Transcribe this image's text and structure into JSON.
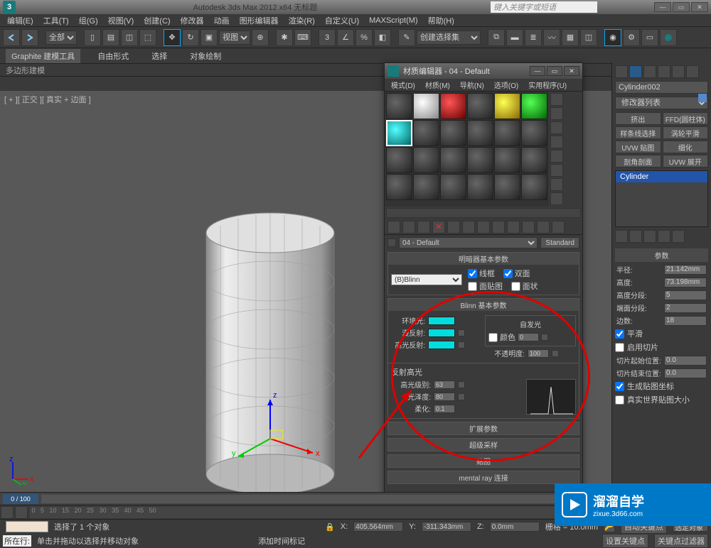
{
  "titlebar": {
    "app_title": "Autodesk 3ds Max 2012 x64   无标题",
    "search_placeholder": "键入关键字或短语"
  },
  "menubar": [
    "编辑(E)",
    "工具(T)",
    "组(G)",
    "视图(V)",
    "创建(C)",
    "修改器",
    "动画",
    "图形编辑器",
    "渲染(R)",
    "自定义(U)",
    "MAXScript(M)",
    "帮助(H)"
  ],
  "toolbar": {
    "layer_selector": "全部",
    "viewport_btn": "视图",
    "selection_set": "创建选择集"
  },
  "ribbon": {
    "tabs": [
      "Graphite 建模工具",
      "自由形式",
      "选择",
      "对象绘制"
    ],
    "sub": "多边形建模"
  },
  "viewport": {
    "label": "[ + ][ 正交 ][ 真实 + 边面 ]"
  },
  "rightpanel": {
    "object_name": "Cylinder002",
    "modifier_list": "修改器列表",
    "buttons": [
      [
        "挤出",
        "FFD(圆柱体)"
      ],
      [
        "样条线选择",
        "涡轮平滑"
      ],
      [
        "UVW 贴图",
        "细化"
      ],
      [
        "剖角剖面",
        "UVW 展开"
      ]
    ],
    "stack_item": "Cylinder",
    "rollup_title": "参数",
    "params": {
      "radius": {
        "label": "半径:",
        "value": "21.142mm"
      },
      "height": {
        "label": "高度:",
        "value": "73.198mm"
      },
      "height_segs": {
        "label": "高度分段:",
        "value": "5"
      },
      "cap_segs": {
        "label": "端面分段:",
        "value": "2"
      },
      "sides": {
        "label": "边数:",
        "value": "18"
      },
      "smooth": {
        "label": "平滑",
        "checked": true
      },
      "slice": {
        "label": "启用切片",
        "checked": false
      },
      "slice_from": {
        "label": "切片起始位置:",
        "value": "0.0"
      },
      "slice_to": {
        "label": "切片结束位置:",
        "value": "0.0"
      },
      "gen_uv": {
        "label": "生成贴图坐标",
        "checked": true
      },
      "real_world": {
        "label": "真实世界贴图大小",
        "checked": false
      }
    }
  },
  "material_editor": {
    "window_title": "材质编辑器 - 04 - Default",
    "menu": [
      "模式(D)",
      "材质(M)",
      "导航(N)",
      "选项(O)",
      "实用程序(U)"
    ],
    "material_name": "04 - Default",
    "type_button": "Standard",
    "rollup_shader": {
      "title": "明暗器基本参数",
      "shader": "(B)Blinn",
      "wire": "线框",
      "two_sided": "双面",
      "face_map": "面贴图",
      "faceted": "面状"
    },
    "rollup_blinn": {
      "title": "Blinn 基本参数",
      "ambient": "环境光:",
      "diffuse": "漫反射:",
      "specular": "高光反射:",
      "self_illum_title": "自发光",
      "self_illum_color": "颜色",
      "self_illum_value": "0",
      "opacity_label": "不透明度:",
      "opacity_value": "100",
      "spec_title": "反射高光",
      "spec_level": {
        "label": "高光级别:",
        "value": "63"
      },
      "glossiness": {
        "label": "光泽度:",
        "value": "80"
      },
      "soften": {
        "label": "柔化:",
        "value": "0.1"
      }
    },
    "extra_rollups": [
      "扩展参数",
      "超级采样",
      "贴图",
      "mental ray 连接"
    ]
  },
  "statusbar": {
    "timeframe": "0 / 100",
    "sel_count": "选择了 1 个对象",
    "hint": "单击并拖动以选择并移动对象",
    "timetag": "添加时间标记",
    "x": "X:",
    "x_val": "405.564mm",
    "y": "Y:",
    "y_val": "-311.343mm",
    "z": "Z:",
    "z_val": "0.0mm",
    "grid": "栅格 = 10.0mm",
    "autokey": "自动关键点",
    "selected": "选定对象",
    "setkey": "设置关键点",
    "keyfilter": "关键点过滤器",
    "now": "所在行:"
  },
  "watermark": {
    "big": "溜溜自学",
    "small": "zixue.3d66.com"
  }
}
